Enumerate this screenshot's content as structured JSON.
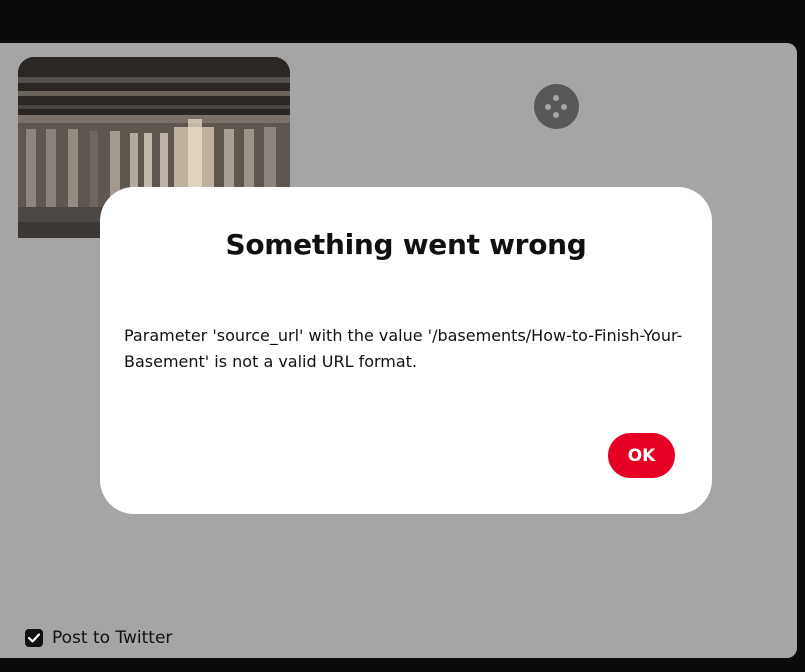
{
  "dialog": {
    "title": "Something went wrong",
    "message": "Parameter 'source_url' with the value '/basements/How-to-Finish-Your-Basement' is not a valid URL format.",
    "ok_label": "OK"
  },
  "twitter_option": {
    "label": "Post to Twitter",
    "checked": true
  },
  "icons": {
    "loader": "loading-spinner-icon",
    "checkbox": "checkmark-icon",
    "thumbnail": "basement-photo"
  },
  "colors": {
    "ok_button": "#e60023",
    "overlay_gray": "#a5a5a5",
    "page_dark": "#0b0b0b",
    "loader": "#585858"
  }
}
